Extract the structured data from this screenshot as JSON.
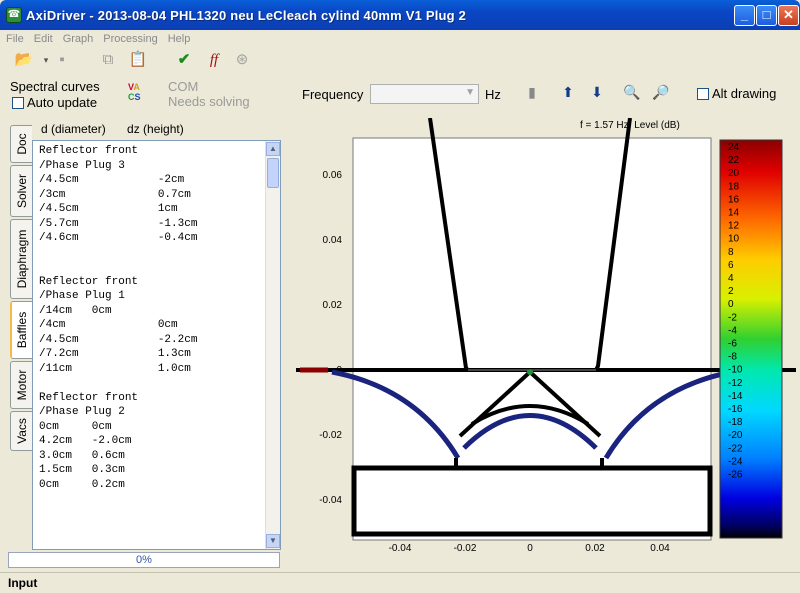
{
  "window": {
    "title": "AxiDriver - 2013-08-04 PHL1320 neu LeCleach cylind 40mm V1 Plug 2",
    "minimize": "_",
    "maximize": "□",
    "close": "✕"
  },
  "menu": [
    "File",
    "Edit",
    "Graph",
    "Processing",
    "Help"
  ],
  "controls": {
    "spectral_label": "Spectral curves",
    "auto_update_label": "Auto update",
    "com_line1": "COM",
    "com_line2": "Needs solving",
    "frequency_label": "Frequency",
    "frequency_value": "",
    "hz_label": "Hz",
    "alt_drawing_label": "Alt drawing"
  },
  "panel": {
    "col1": "d (diameter)",
    "col2": "dz (height)",
    "text": "Reflector front\n/Phase Plug 3\n/4.5cm            -2cm\n/3cm              0.7cm\n/4.5cm            1cm\n/5.7cm            -1.3cm\n/4.6cm            -0.4cm\n\n\nReflector front\n/Phase Plug 1\n/14cm   0cm\n/4cm              0cm\n/4.5cm            -2.2cm\n/7.2cm            1.3cm\n/11cm             1.0cm\n\nReflector front\n/Phase Plug 2\n0cm     0cm\n4.2cm   -2.0cm\n3.0cm   0.6cm\n1.5cm   0.3cm\n0cm     0.2cm"
  },
  "tabs": [
    "Doc",
    "Solver",
    "Diaphragm",
    "Baffles",
    "Motor",
    "Vacs"
  ],
  "active_tab": "Baffles",
  "progress": {
    "label": "0%",
    "value": 0
  },
  "status": {
    "label": "Input"
  },
  "plot": {
    "header": "f = 1.57   Hz, Level  (dB)",
    "x_ticks": [
      "-0.04",
      "-0.02",
      "0",
      "0.02",
      "0.04"
    ],
    "y_ticks": [
      "0.06",
      "0.04",
      "0.02",
      "0",
      "-0.02",
      "-0.04"
    ],
    "colorbar_ticks": [
      "24",
      "22",
      "20",
      "18",
      "16",
      "14",
      "12",
      "10",
      "8",
      "6",
      "4",
      "2",
      "0",
      "-2",
      "-4",
      "-6",
      "-8",
      "-10",
      "-12",
      "-14",
      "-16",
      "-18",
      "-20",
      "-22",
      "-24",
      "-26"
    ],
    "colors": {
      "structure": "#000000",
      "diaphragm": "#1a237e",
      "baffle_edge": "#8b0000",
      "background": "#ffffff"
    }
  }
}
